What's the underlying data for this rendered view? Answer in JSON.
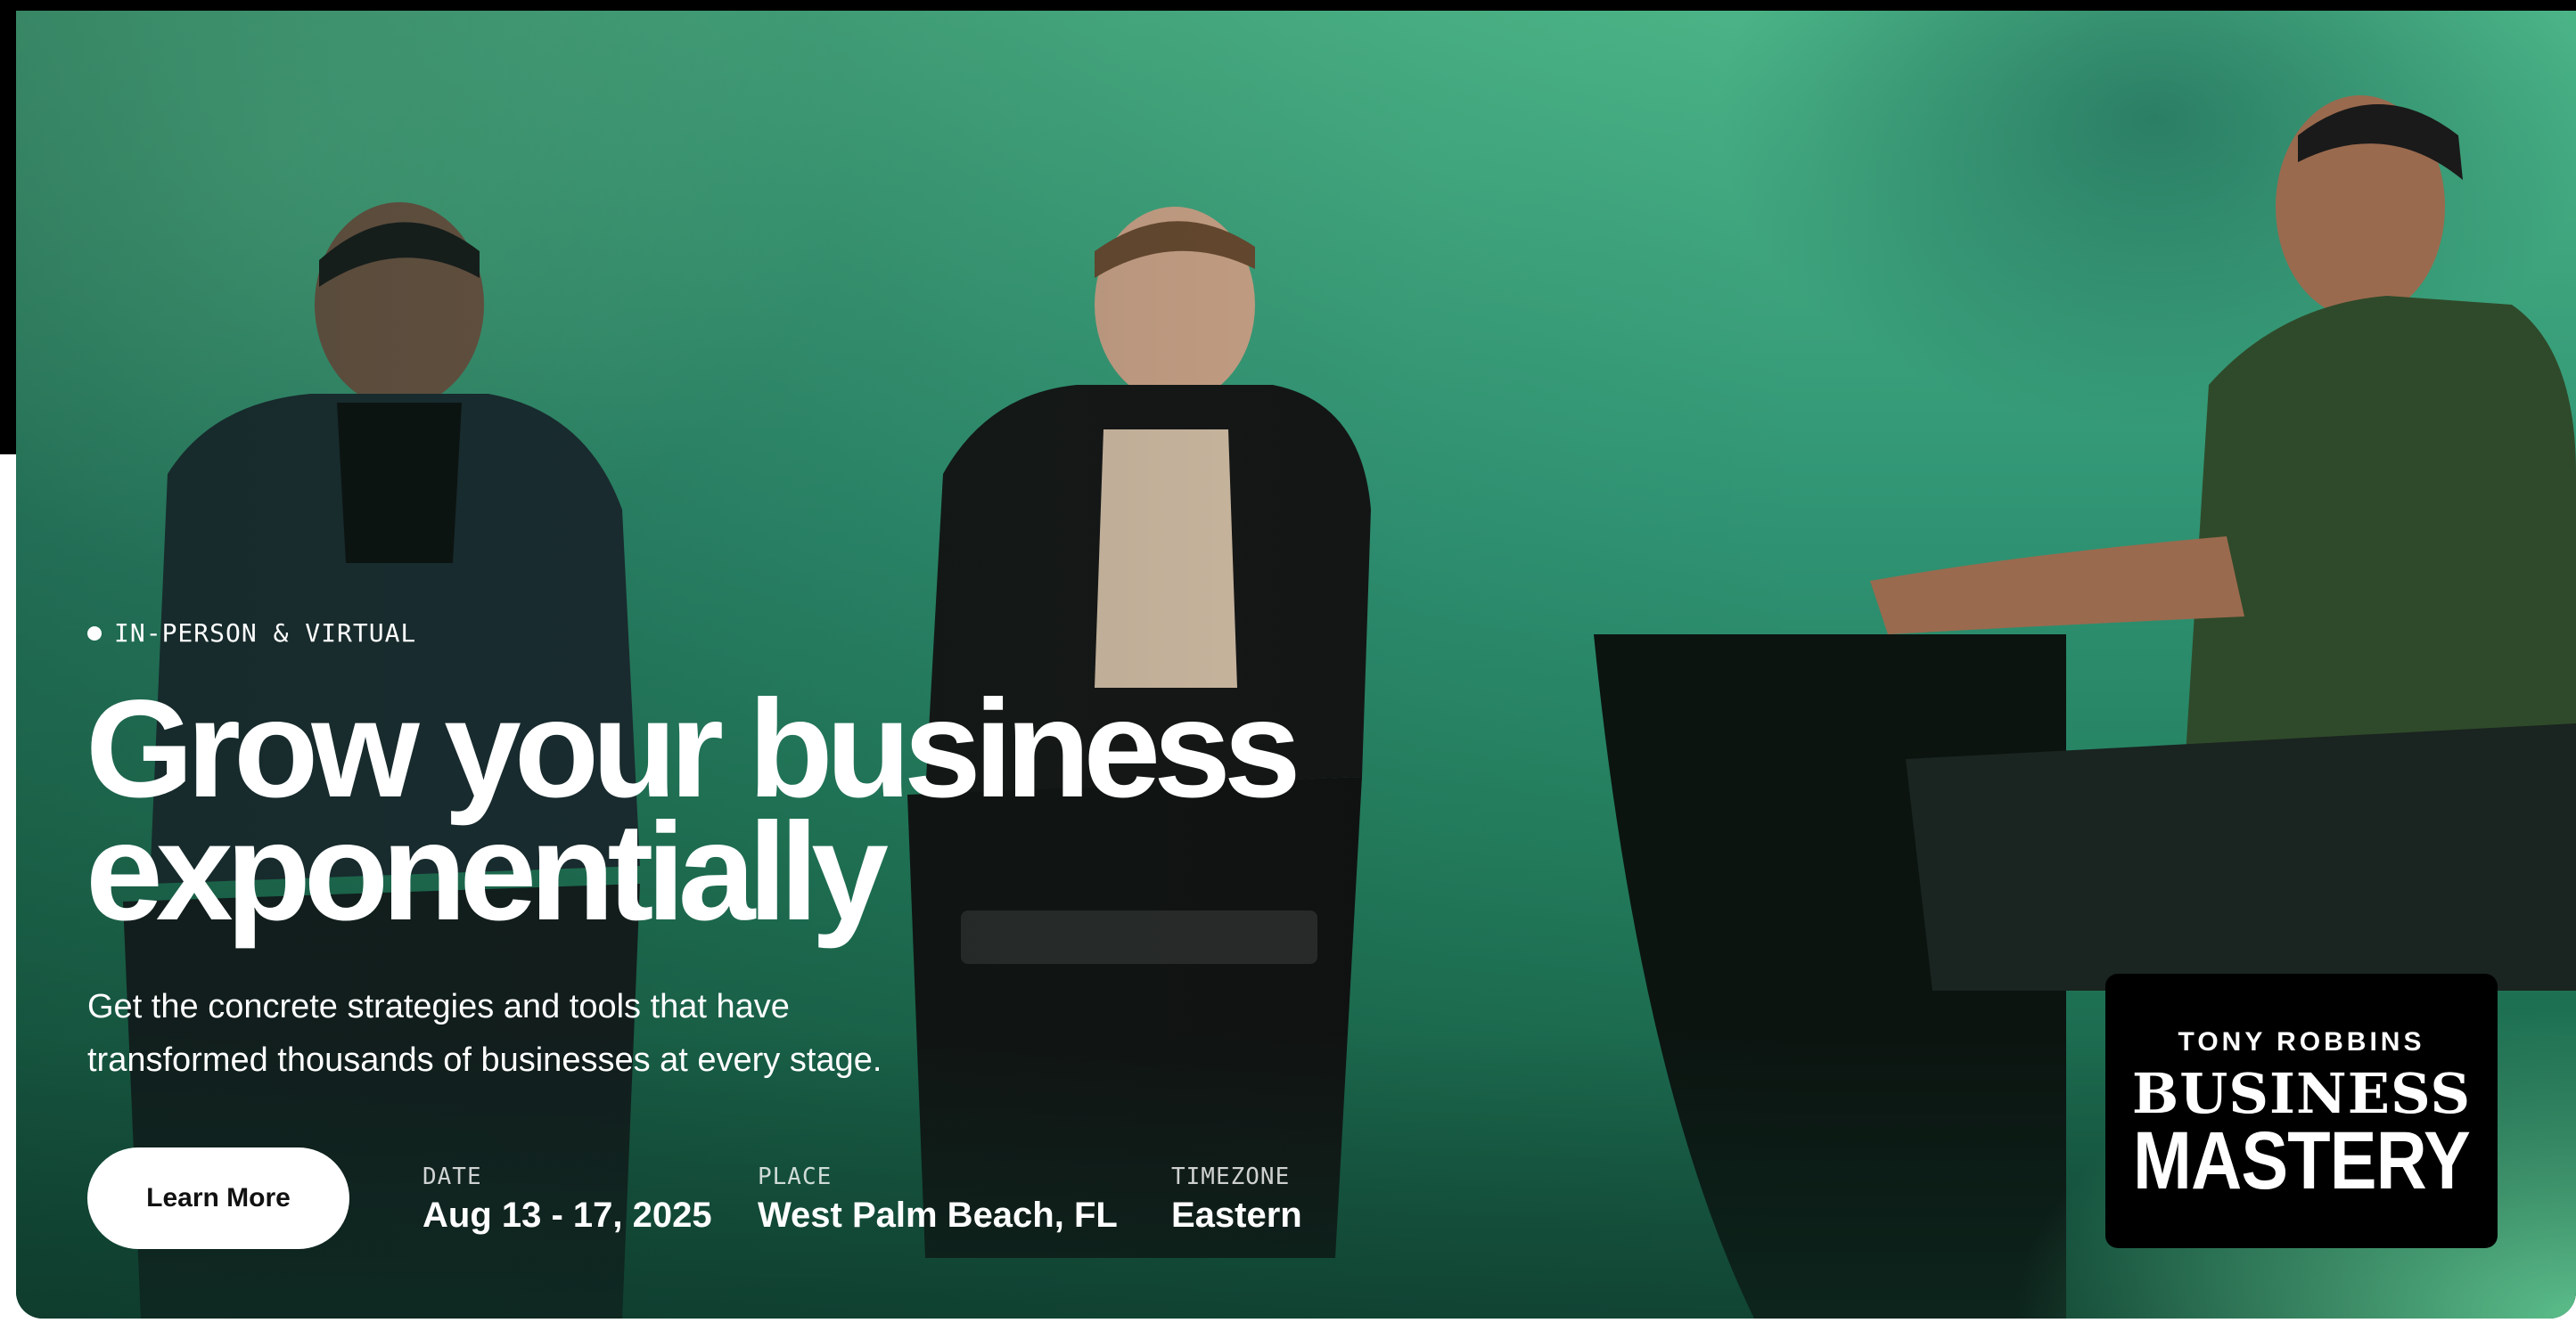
{
  "hero": {
    "badge": "IN-PERSON & VIRTUAL",
    "headline_line1": "Grow your business",
    "headline_line2": "exponentially",
    "subhead_line1": "Get the concrete strategies and tools that have",
    "subhead_line2": "transformed thousands of businesses at every stage.",
    "cta_label": "Learn More",
    "details": {
      "date_label": "DATE",
      "date_value": "Aug 13 - 17, 2025",
      "place_label": "PLACE",
      "place_value": "West Palm Beach, FL",
      "timezone_label": "TIMEZONE",
      "timezone_value": "Eastern"
    }
  },
  "logo": {
    "top": "TONY ROBBINS",
    "middle": "BUSINESS",
    "bottom": "MASTERY"
  },
  "colors": {
    "hero_green": "#2f9a73",
    "glow_green": "#6edca0",
    "text": "#ffffff",
    "button_bg": "#ffffff",
    "logo_bg": "#000000"
  }
}
